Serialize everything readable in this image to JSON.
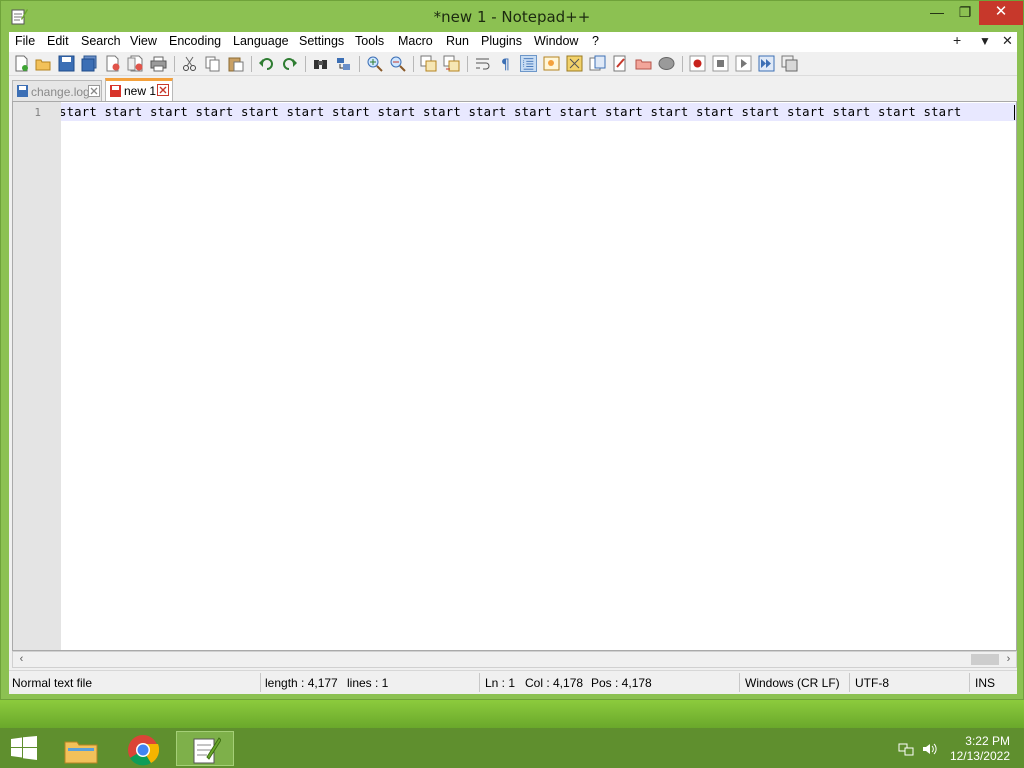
{
  "window": {
    "title": "*new 1 - Notepad++",
    "minimize_glyph": "—",
    "maximize_glyph": "❐",
    "close_glyph": "✕"
  },
  "menu": {
    "items": [
      "File",
      "Edit",
      "Search",
      "View",
      "Encoding",
      "Language",
      "Settings",
      "Tools",
      "Macro",
      "Run",
      "Plugins",
      "Window",
      "?"
    ],
    "right_add": "+",
    "right_dropdown": "▼",
    "right_close": "✕"
  },
  "toolbar": {
    "icons": [
      "new-file-icon",
      "open-file-icon",
      "save-icon",
      "save-all-icon",
      "close-icon",
      "close-all-icon",
      "print-icon",
      "cut-icon",
      "copy-icon",
      "paste-icon",
      "undo-icon",
      "redo-icon",
      "find-icon",
      "replace-icon",
      "zoom-in-icon",
      "zoom-out-icon",
      "sync-vertical-icon",
      "sync-horizontal-icon",
      "word-wrap-icon",
      "show-all-characters-icon",
      "indent-guide-icon",
      "user-defined-language-icon",
      "document-map-icon",
      "function-list-icon",
      "folder-as-workspace-icon",
      "monitoring-icon",
      "record-macro-icon",
      "stop-recording-icon",
      "playback-macro-icon",
      "run-macro-multiple-icon",
      "save-macro-icon"
    ]
  },
  "tabs": [
    {
      "label": "change.log",
      "active": false
    },
    {
      "label": "new 1",
      "active": true
    }
  ],
  "editor": {
    "line_number": "1",
    "line_text": "start start start start start start start start start start start start start start start start start start start start"
  },
  "statusbar": {
    "file_type": "Normal text file",
    "length": "length : 4,177",
    "lines": "lines : 1",
    "ln": "Ln : 1",
    "col": "Col : 4,178",
    "pos": "Pos : 4,178",
    "eol": "Windows (CR LF)",
    "encoding": "UTF-8",
    "mode": "INS"
  },
  "taskbar": {
    "apps": [
      "file-explorer-icon",
      "chrome-icon",
      "notepad-plus-plus-icon"
    ],
    "time": "3:22 PM",
    "date": "12/13/2022"
  },
  "colors": {
    "accent": "#8cc152",
    "taskbar": "#5f8f2e",
    "close": "#c7382b",
    "tab_active_top": "#f4a13c",
    "current_line": "#e8e8ff"
  }
}
